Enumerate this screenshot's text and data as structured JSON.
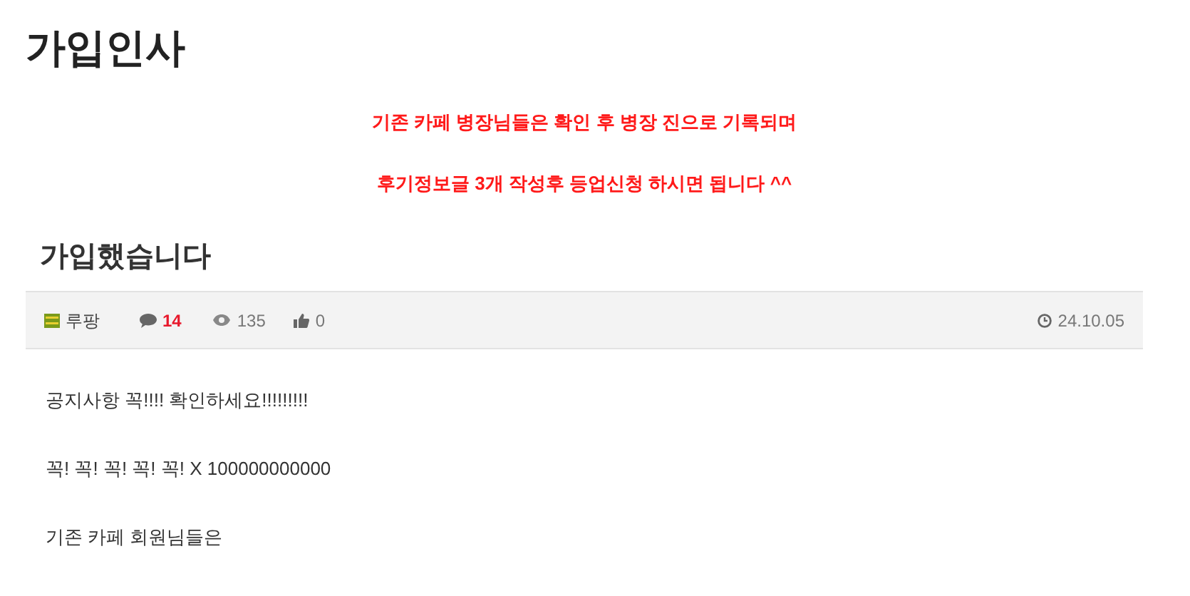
{
  "board_title": "가입인사",
  "notices": [
    "기존 카페 병장님들은 확인 후 병장 진으로 기록되며",
    "후기정보글 3개 작성후 등업신청 하시면 됩니다 ^^"
  ],
  "post": {
    "title": "가입했습니다",
    "author": "루팡",
    "comments": "14",
    "views": "135",
    "likes": "0",
    "date": "24.10.05",
    "body": [
      "공지사항 꼭!!!! 확인하세요!!!!!!!!!",
      "꼭! 꼭! 꼭! 꼭! 꼭! X 100000000000",
      "기존 카페 회원님들은"
    ]
  }
}
